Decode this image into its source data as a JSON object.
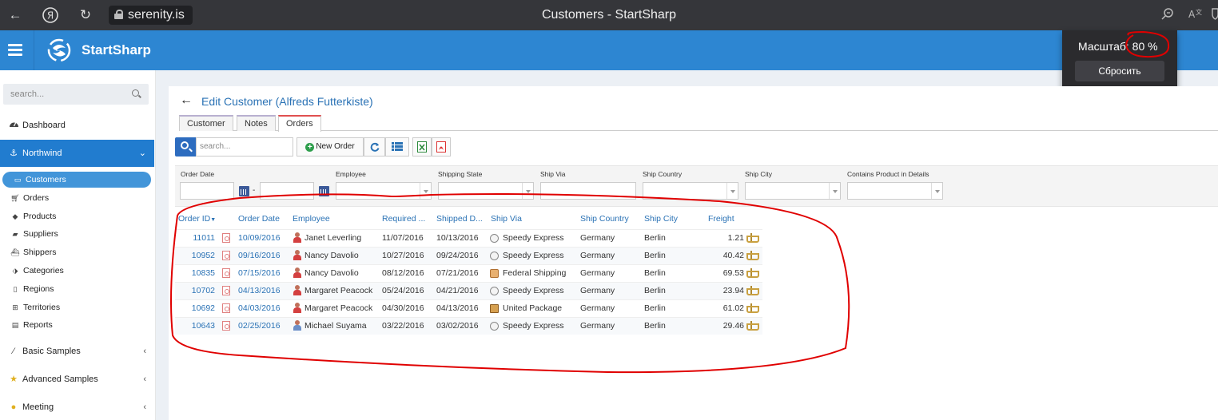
{
  "browser": {
    "url": "serenity.is",
    "window_title": "Customers - StartSharp"
  },
  "zoom_popup": {
    "label": "Масштаб: 80 %",
    "reset_label": "Сбросить"
  },
  "app": {
    "brand": "StartSharp"
  },
  "sidebar": {
    "search_placeholder": "search...",
    "dashboard": "Dashboard",
    "northwind": "Northwind",
    "sub_items": [
      "Customers",
      "Orders",
      "Products",
      "Suppliers",
      "Shippers",
      "Categories",
      "Regions",
      "Territories",
      "Reports"
    ],
    "basic_samples": "Basic Samples",
    "advanced_samples": "Advanced Samples",
    "meeting": "Meeting"
  },
  "page": {
    "title": "Edit Customer (Alfreds Futterkiste)",
    "tabs": [
      "Customer",
      "Notes",
      "Orders"
    ],
    "active_tab": "Orders"
  },
  "toolbar": {
    "search_placeholder": "search...",
    "new_order": "New Order"
  },
  "filters": {
    "order_date": "Order Date",
    "date_separator": "-",
    "employee": "Employee",
    "shipping_state": "Shipping State",
    "ship_via": "Ship Via",
    "ship_country": "Ship Country",
    "ship_city": "Ship City",
    "contains_product": "Contains Product in Details"
  },
  "grid": {
    "columns": [
      "Order ID",
      "Order Date",
      "Employee",
      "Required ...",
      "Shipped D...",
      "Ship Via",
      "Ship Country",
      "Ship City",
      "Freight"
    ],
    "sort_indicator": "▼",
    "rows": [
      {
        "id": "11011",
        "order_date": "10/09/2016",
        "employee": "Janet Leverling",
        "required": "11/07/2016",
        "shipped": "10/13/2016",
        "ship_via": "Speedy Express",
        "country": "Germany",
        "city": "Berlin",
        "freight": "1.21"
      },
      {
        "id": "10952",
        "order_date": "09/16/2016",
        "employee": "Nancy Davolio",
        "required": "10/27/2016",
        "shipped": "09/24/2016",
        "ship_via": "Speedy Express",
        "country": "Germany",
        "city": "Berlin",
        "freight": "40.42"
      },
      {
        "id": "10835",
        "order_date": "07/15/2016",
        "employee": "Nancy Davolio",
        "required": "08/12/2016",
        "shipped": "07/21/2016",
        "ship_via": "Federal Shipping",
        "country": "Germany",
        "city": "Berlin",
        "freight": "69.53"
      },
      {
        "id": "10702",
        "order_date": "04/13/2016",
        "employee": "Margaret Peacock",
        "required": "05/24/2016",
        "shipped": "04/21/2016",
        "ship_via": "Speedy Express",
        "country": "Germany",
        "city": "Berlin",
        "freight": "23.94"
      },
      {
        "id": "10692",
        "order_date": "04/03/2016",
        "employee": "Margaret Peacock",
        "required": "04/30/2016",
        "shipped": "04/13/2016",
        "ship_via": "United Package",
        "country": "Germany",
        "city": "Berlin",
        "freight": "61.02"
      },
      {
        "id": "10643",
        "order_date": "02/25/2016",
        "employee": "Michael Suyama",
        "required": "03/22/2016",
        "shipped": "03/02/2016",
        "ship_via": "Speedy Express",
        "country": "Germany",
        "city": "Berlin",
        "freight": "29.46"
      }
    ]
  },
  "colors": {
    "header_blue": "#2d86d2",
    "link_blue": "#2a72b5",
    "annotation_red": "#e00000"
  }
}
